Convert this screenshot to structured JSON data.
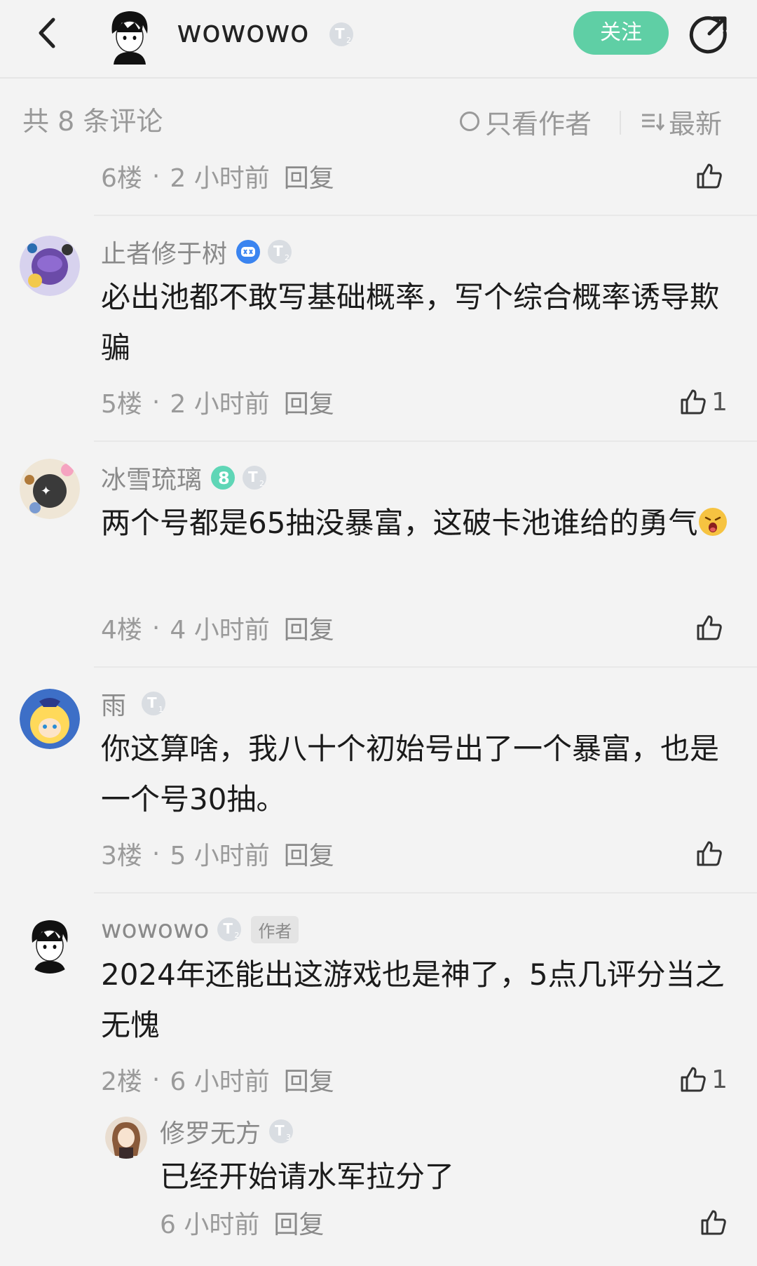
{
  "header": {
    "username": "wowowo",
    "follow_label": "关注"
  },
  "filter": {
    "count_label": "共 8 条评论",
    "author_only_label": "只看作者",
    "sort_label": "最新"
  },
  "comments": [
    {
      "floor": "6楼",
      "time": "2 小时前",
      "reply_label": "回复",
      "likes": ""
    },
    {
      "username": "止者修于树",
      "text": "必出池都不敢写基础概率，写个综合概率诱导欺骗",
      "floor": "5楼",
      "time": "2 小时前",
      "reply_label": "回复",
      "likes": "1"
    },
    {
      "username": "冰雪琉璃",
      "text": "两个号都是65抽没暴富，这破卡池谁给的勇气",
      "floor": "4楼",
      "time": "4 小时前",
      "reply_label": "回复",
      "likes": ""
    },
    {
      "username": "雨",
      "text": "你这算啥，我八十个初始号出了一个暴富，也是一个号30抽。",
      "floor": "3楼",
      "time": "5 小时前",
      "reply_label": "回复",
      "likes": ""
    },
    {
      "username": "wowowo",
      "author_tag": "作者",
      "text": "2024年还能出这游戏也是神了，5点几评分当之无愧",
      "floor": "2楼",
      "time": "6 小时前",
      "reply_label": "回复",
      "likes": "1",
      "reply": {
        "username": "修罗无方",
        "text": "已经开始请水军拉分了",
        "time": "6 小时前",
        "reply_label": "回复"
      }
    }
  ],
  "colors": {
    "accent": "#5fcfa5",
    "background": "#f3f3f3",
    "muted": "#9a9a9a"
  },
  "icons": [
    "back-arrow-icon",
    "share-icon",
    "radio-circle-icon",
    "sort-icon",
    "thumbs-up-icon",
    "level-badge-icon",
    "verified-badge-icon",
    "level-8-badge-icon",
    "dizzy-face-emoji"
  ]
}
